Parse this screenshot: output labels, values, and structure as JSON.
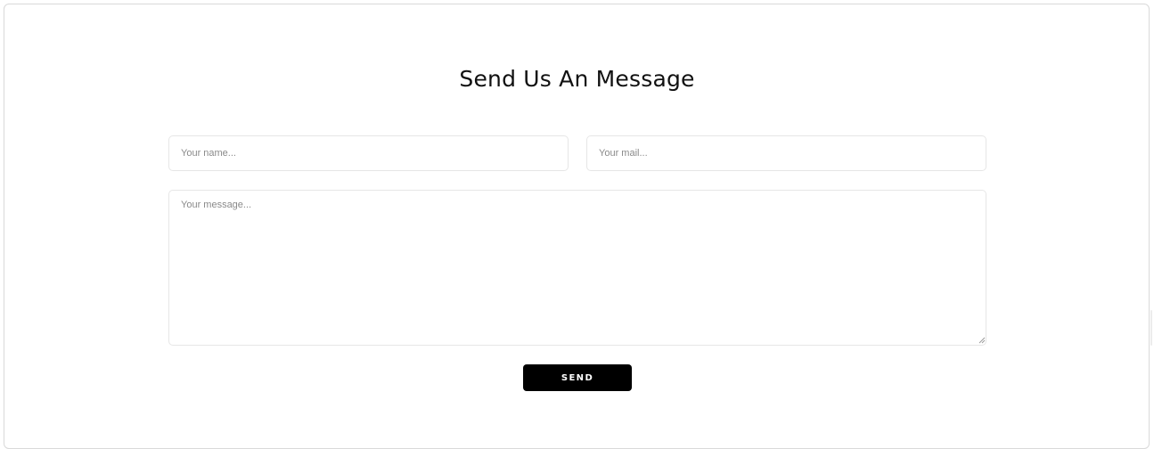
{
  "form": {
    "title": "Send Us An Message",
    "name_placeholder": "Your name...",
    "mail_placeholder": "Your mail...",
    "message_placeholder": "Your message...",
    "send_label": "SEND"
  },
  "colors": {
    "button_background": "#000000",
    "button_text": "#ffffff",
    "field_border": "#e6e6e6",
    "placeholder_text": "#8a8a8a"
  },
  "icons": {
    "resize_handle": "resize-handle-icon"
  }
}
